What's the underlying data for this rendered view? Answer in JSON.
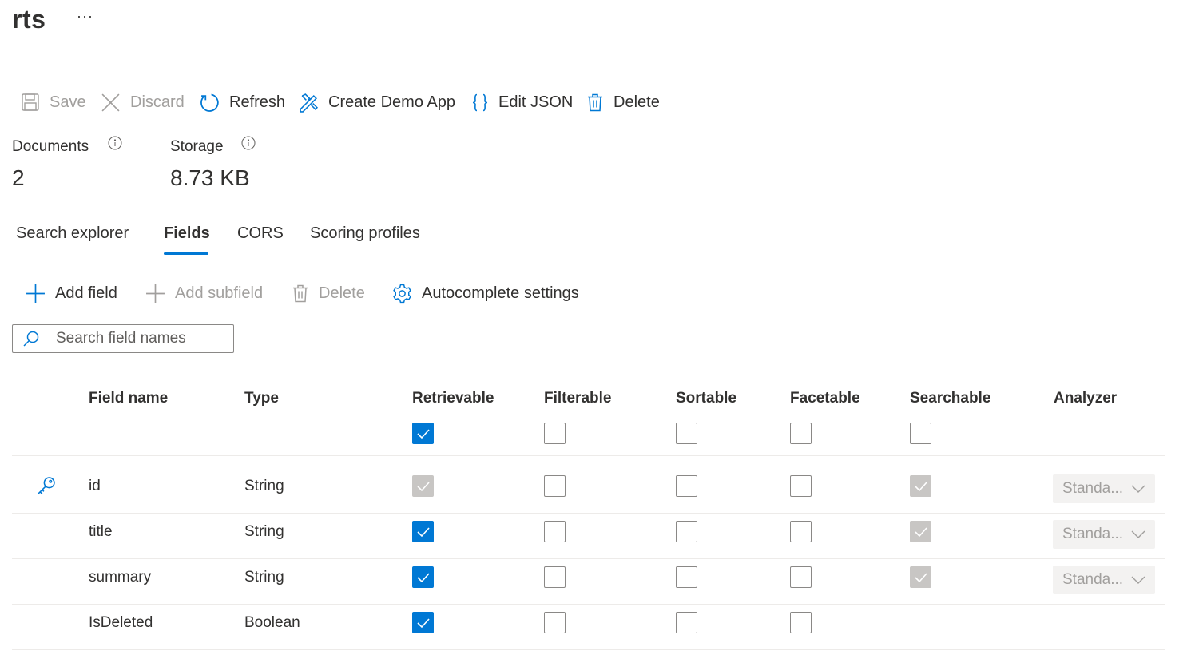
{
  "header": {
    "title": "rts",
    "more": "···"
  },
  "toolbar": {
    "save": "Save",
    "discard": "Discard",
    "refresh": "Refresh",
    "create_demo_app": "Create Demo App",
    "edit_json": "Edit JSON",
    "delete": "Delete"
  },
  "stats": {
    "documents_label": "Documents",
    "documents_value": "2",
    "storage_label": "Storage",
    "storage_value": "8.73 KB"
  },
  "tabs": [
    {
      "label": "Search explorer",
      "active": false
    },
    {
      "label": "Fields",
      "active": true
    },
    {
      "label": "CORS",
      "active": false
    },
    {
      "label": "Scoring profiles",
      "active": false
    }
  ],
  "fields_toolbar": {
    "add_field": "Add field",
    "add_subfield": "Add subfield",
    "delete": "Delete",
    "autocomplete": "Autocomplete settings"
  },
  "search": {
    "placeholder": "Search field names",
    "value": ""
  },
  "table": {
    "headers": [
      "Field name",
      "Type",
      "Retrievable",
      "Filterable",
      "Sortable",
      "Facetable",
      "Searchable",
      "Analyzer"
    ],
    "header_checks": {
      "retrievable": true,
      "filterable": false,
      "sortable": false,
      "facetable": false,
      "searchable": false
    },
    "rows": [
      {
        "key": true,
        "name": "id",
        "type": "String",
        "retrievable": "disabled-checked",
        "filterable": false,
        "sortable": false,
        "facetable": false,
        "searchable": "disabled-checked",
        "analyzer": "Standa..."
      },
      {
        "key": false,
        "name": "title",
        "type": "String",
        "retrievable": true,
        "filterable": false,
        "sortable": false,
        "facetable": false,
        "searchable": "disabled-checked",
        "analyzer": "Standa..."
      },
      {
        "key": false,
        "name": "summary",
        "type": "String",
        "retrievable": true,
        "filterable": false,
        "sortable": false,
        "facetable": false,
        "searchable": "disabled-checked",
        "analyzer": "Standa..."
      },
      {
        "key": false,
        "name": "IsDeleted",
        "type": "Boolean",
        "retrievable": true,
        "filterable": false,
        "sortable": false,
        "facetable": false,
        "searchable": null,
        "analyzer": null
      }
    ]
  },
  "colors": {
    "accent": "#0078d4",
    "disabled": "#c8c6c4",
    "text": "#323130"
  }
}
